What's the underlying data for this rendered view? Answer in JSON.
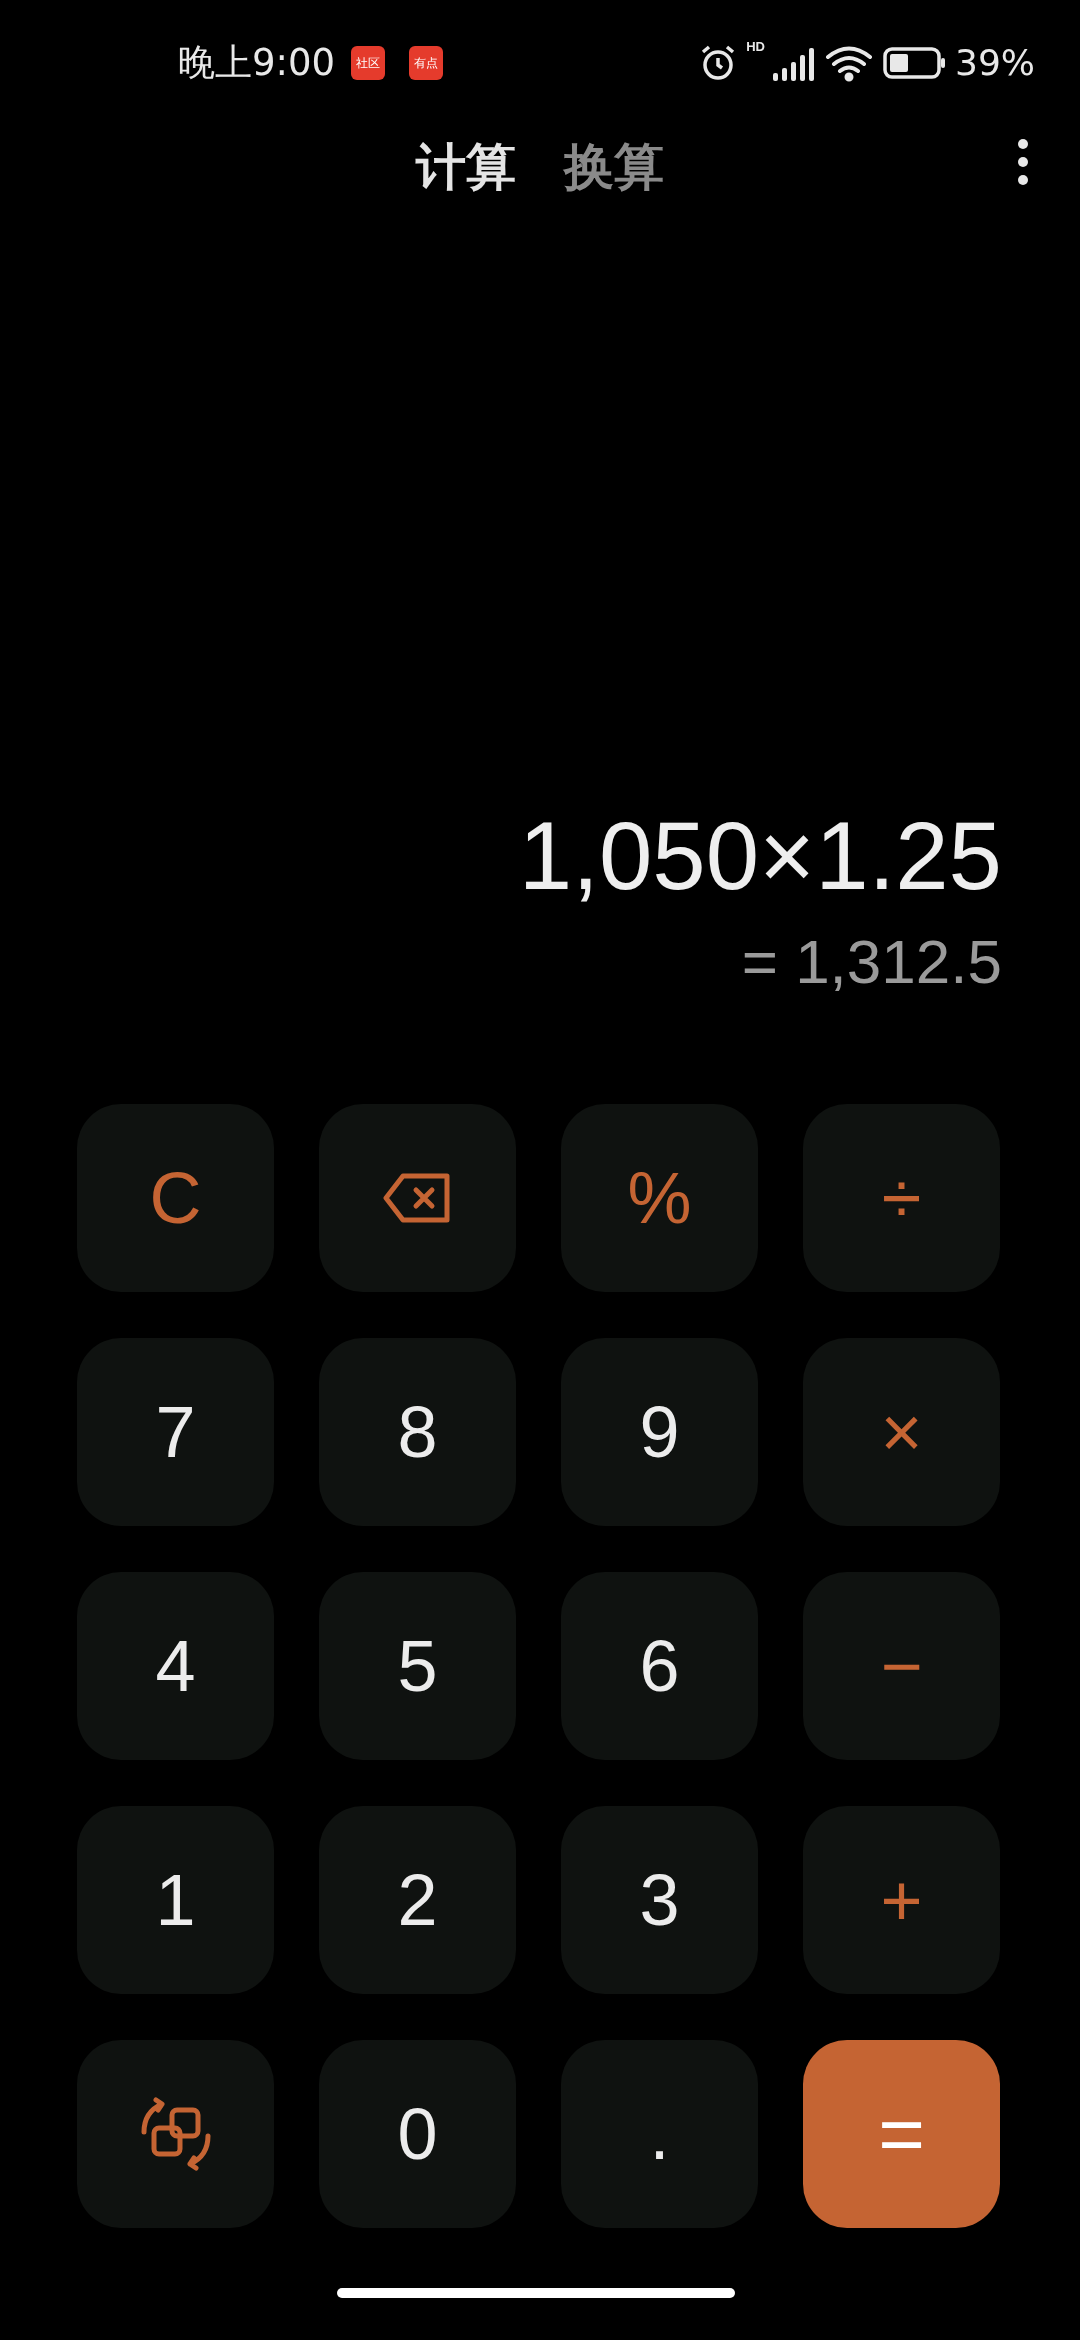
{
  "status_bar": {
    "time": "晚上9:00",
    "notification_icons": [
      "社区",
      "有点"
    ],
    "network_label": "HD",
    "battery": "39%"
  },
  "tabs": [
    {
      "label": "计算",
      "selected": true
    },
    {
      "label": "换算",
      "selected": false
    }
  ],
  "display": {
    "expression": "1,050×1.25",
    "result": "= 1,312.5"
  },
  "keys": [
    {
      "kind": "function",
      "label": "C"
    },
    {
      "kind": "backspace"
    },
    {
      "kind": "function",
      "label": "%"
    },
    {
      "kind": "function",
      "label": "÷"
    },
    {
      "kind": "digit",
      "label": "7"
    },
    {
      "kind": "digit",
      "label": "8"
    },
    {
      "kind": "digit",
      "label": "9"
    },
    {
      "kind": "function",
      "label": "×"
    },
    {
      "kind": "digit",
      "label": "4"
    },
    {
      "kind": "digit",
      "label": "5"
    },
    {
      "kind": "digit",
      "label": "6"
    },
    {
      "kind": "function",
      "label": "−"
    },
    {
      "kind": "digit",
      "label": "1"
    },
    {
      "kind": "digit",
      "label": "2"
    },
    {
      "kind": "digit",
      "label": "3"
    },
    {
      "kind": "function",
      "label": "+"
    },
    {
      "kind": "switch"
    },
    {
      "kind": "digit",
      "label": "0"
    },
    {
      "kind": "digit",
      "label": "."
    },
    {
      "kind": "equals",
      "label": "="
    }
  ]
}
